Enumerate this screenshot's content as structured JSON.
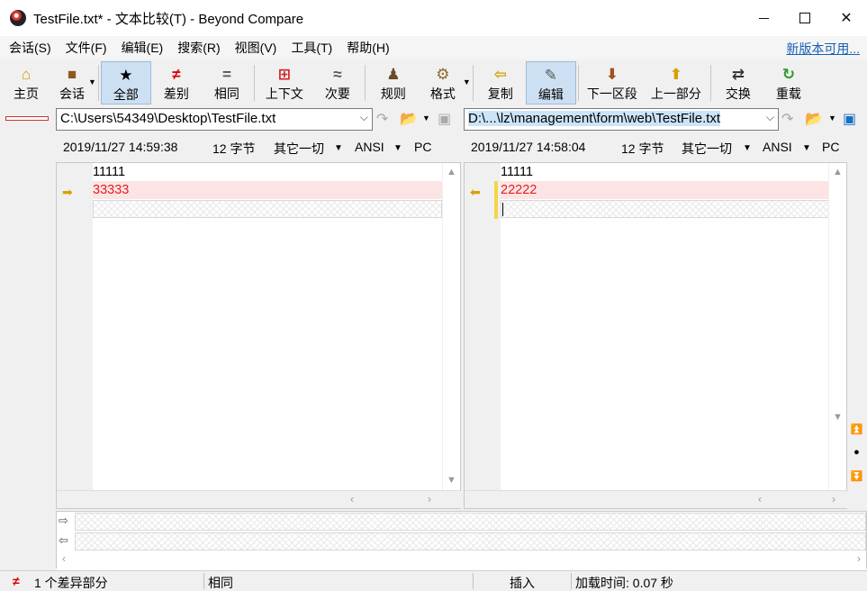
{
  "window": {
    "title": "TestFile.txt* - 文本比较(T) - Beyond Compare"
  },
  "menu": [
    "会话(S)",
    "文件(F)",
    "编辑(E)",
    "搜索(R)",
    "视图(V)",
    "工具(T)",
    "帮助(H)"
  ],
  "new_version_link": "新版本可用...",
  "toolbar": {
    "home": "主页",
    "session": "会话",
    "all": "全部",
    "diffs": "差别",
    "same": "相同",
    "context": "上下文",
    "minor": "次要",
    "rules": "规则",
    "format": "格式",
    "copy": "复制",
    "edit": "编辑",
    "next_section": "下一区段",
    "prev_section": "上一部分",
    "swap": "交换",
    "reload": "重载"
  },
  "left": {
    "path": "C:\\Users\\54349\\Desktop\\TestFile.txt",
    "date": "2019/11/27 14:59:38",
    "size": "12 字节",
    "filter": "其它一切",
    "encoding": "ANSI",
    "eol": "PC",
    "lines": [
      "11111",
      "33333"
    ]
  },
  "right": {
    "path": "D:\\...\\lz\\management\\form\\web\\TestFile.txt",
    "date": "2019/11/27 14:58:04",
    "size": "12 字节",
    "filter": "其它一切",
    "encoding": "ANSI",
    "eol": "PC",
    "lines": [
      "11111",
      "22222"
    ]
  },
  "status": {
    "diffs": "1 个差异部分",
    "same": "相同",
    "insert": "插入",
    "load_time": "加载时间: 0.07 秒"
  },
  "colors": {
    "diff_bg": "#fde4e4",
    "diff_text": "#e02020",
    "accent": "#1a5fb4",
    "toolbar_active": "#cde0f3"
  }
}
